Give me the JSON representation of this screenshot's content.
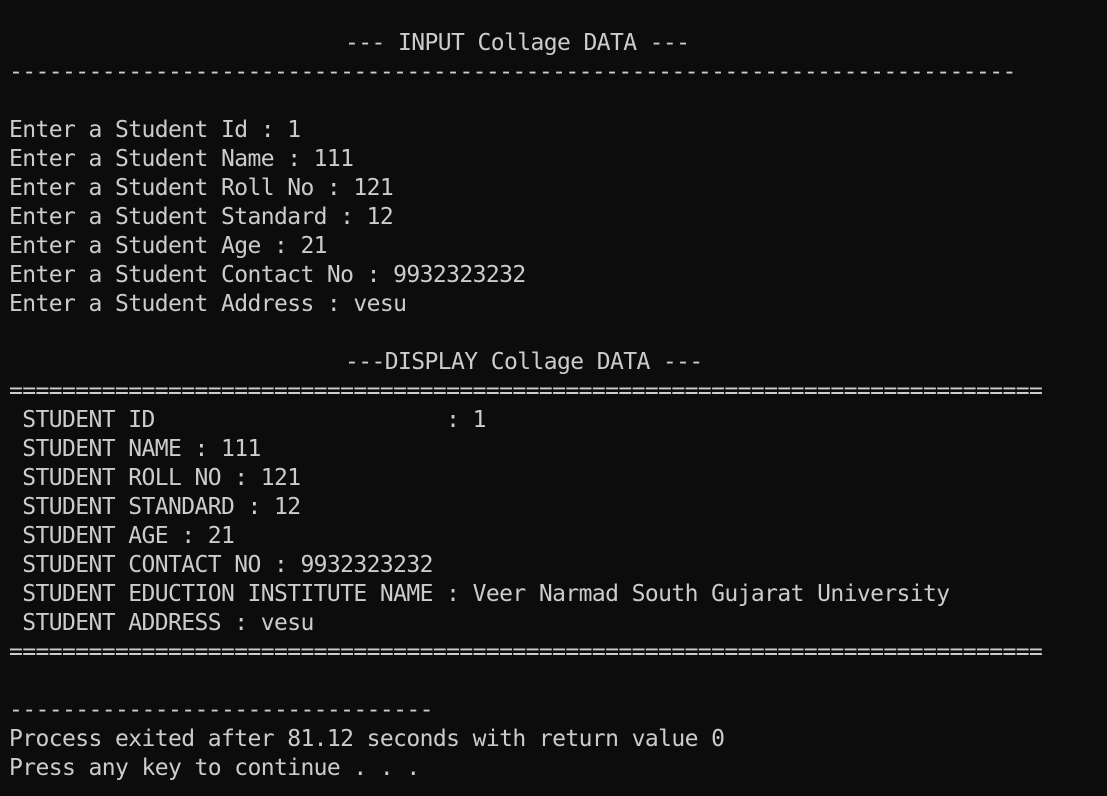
{
  "console": {
    "input_title": "--- INPUT Collage DATA ---",
    "rule_dash": "----------------------------------------------------------------------------",
    "input_lines": [
      "Enter a Student Id : 1",
      "Enter a Student Name : 111",
      "Enter a Student Roll No : 121",
      "Enter a Student Standard : 12",
      "Enter a Student Age : 21",
      "Enter a Student Contact No : 9932323232",
      "Enter a Student Address : vesu"
    ],
    "display_title": "---DISPLAY Collage DATA ---",
    "rule_equals": "==============================================================================",
    "display_lines": [
      " STUDENT ID                      : 1",
      " STUDENT NAME : 111",
      " STUDENT ROLL NO : 121",
      " STUDENT STANDARD : 12",
      " STUDENT AGE : 21",
      " STUDENT CONTACT NO : 9932323232",
      " STUDENT EDUCTION INSTITUTE NAME : Veer Narmad South Gujarat University",
      " STUDENT ADDRESS : vesu"
    ],
    "short_rule": "--------------------------------",
    "process_exit": "Process exited after 81.12 seconds with return value 0",
    "press_key": "Press any key to continue . . ."
  }
}
